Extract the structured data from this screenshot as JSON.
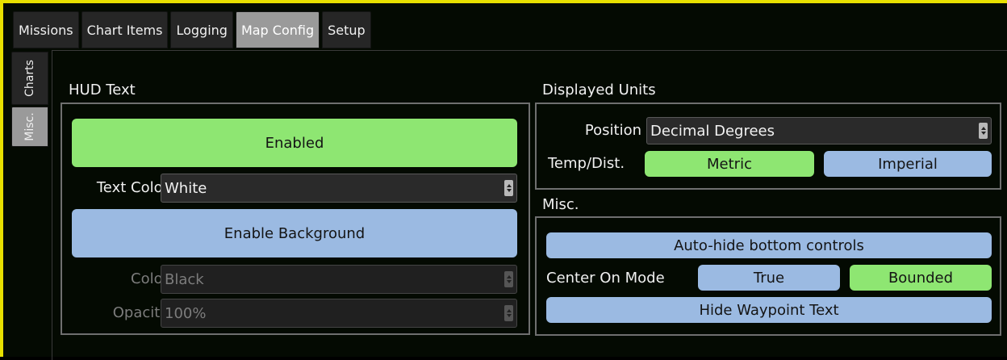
{
  "tabs": [
    {
      "label": "Missions",
      "active": false
    },
    {
      "label": "Chart Items",
      "active": false
    },
    {
      "label": "Logging",
      "active": false
    },
    {
      "label": "Map Config",
      "active": true
    },
    {
      "label": "Setup",
      "active": false
    }
  ],
  "side_tabs": [
    {
      "label": "Charts",
      "active": false
    },
    {
      "label": "Misc.",
      "active": true
    }
  ],
  "hud_text": {
    "title": "HUD Text",
    "enabled_button": "Enabled",
    "text_color_label": "Text Color",
    "text_color_value": "White",
    "enable_background_button": "Enable Background",
    "color_label": "Color",
    "color_value": "Black",
    "opacity_label": "Opacity",
    "opacity_value": "100%"
  },
  "displayed_units": {
    "title": "Displayed Units",
    "position_label": "Position",
    "position_value": "Decimal Degrees",
    "temp_dist_label": "Temp/Dist.",
    "metric_button": "Metric",
    "imperial_button": "Imperial"
  },
  "misc": {
    "title": "Misc.",
    "auto_hide_button": "Auto-hide bottom controls",
    "center_on_mode_label": "Center On Mode",
    "true_button": "True",
    "bounded_button": "Bounded",
    "hide_waypoint_button": "Hide Waypoint Text"
  },
  "colors": {
    "accent_green": "#8ee672",
    "accent_blue": "#9bbae2",
    "frame_yellow": "#e8e000",
    "background": "#040a02"
  }
}
